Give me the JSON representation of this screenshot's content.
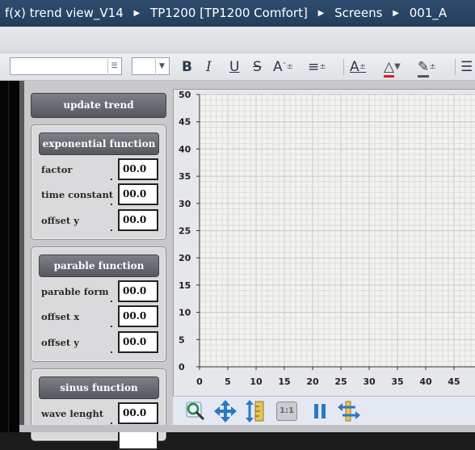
{
  "titlebar": {
    "crumbs": [
      "f(x) trend view_V14",
      "TP1200 [TP1200 Comfort]",
      "Screens",
      "001_A"
    ]
  },
  "format_toolbar": {
    "bold": "B",
    "italic": "I",
    "underline": "U",
    "strike": "S",
    "size_label": "A"
  },
  "update_button": "update trend",
  "groups": [
    {
      "title": "exponential function",
      "fields": [
        {
          "label": "factor",
          "value": "00.0"
        },
        {
          "label": "time constant",
          "value": "00.0"
        },
        {
          "label": "offset y",
          "value": "00.0"
        }
      ]
    },
    {
      "title": "parable function",
      "fields": [
        {
          "label": "parable form",
          "value": "00.0"
        },
        {
          "label": "offset x",
          "value": "00.0"
        },
        {
          "label": "offset y",
          "value": "00.0"
        }
      ]
    },
    {
      "title": "sinus function",
      "fields": [
        {
          "label": "wave lenght",
          "value": "00.0"
        }
      ]
    }
  ],
  "chart_data": {
    "type": "line",
    "x_ticks": [
      "0",
      "5",
      "10",
      "15",
      "20",
      "25",
      "30",
      "35",
      "40",
      "45"
    ],
    "y_ticks": [
      "0",
      "5",
      "10",
      "15",
      "20",
      "25",
      "30",
      "35",
      "40",
      "45",
      "50"
    ],
    "xlim": [
      0,
      50
    ],
    "ylim": [
      0,
      50
    ],
    "grid": true,
    "series": []
  },
  "chart_toolbar": {
    "icons": [
      "zoom-icon",
      "pan-icon",
      "ruler-icon",
      "one-to-one-icon",
      "pause-icon",
      "scroll-axis-icon"
    ],
    "one_to_one_label": "1:1"
  },
  "colors": {
    "accent": "#2a78c4",
    "grid_major": "#c8c9c4",
    "grid_minor": "#dcddd8"
  }
}
